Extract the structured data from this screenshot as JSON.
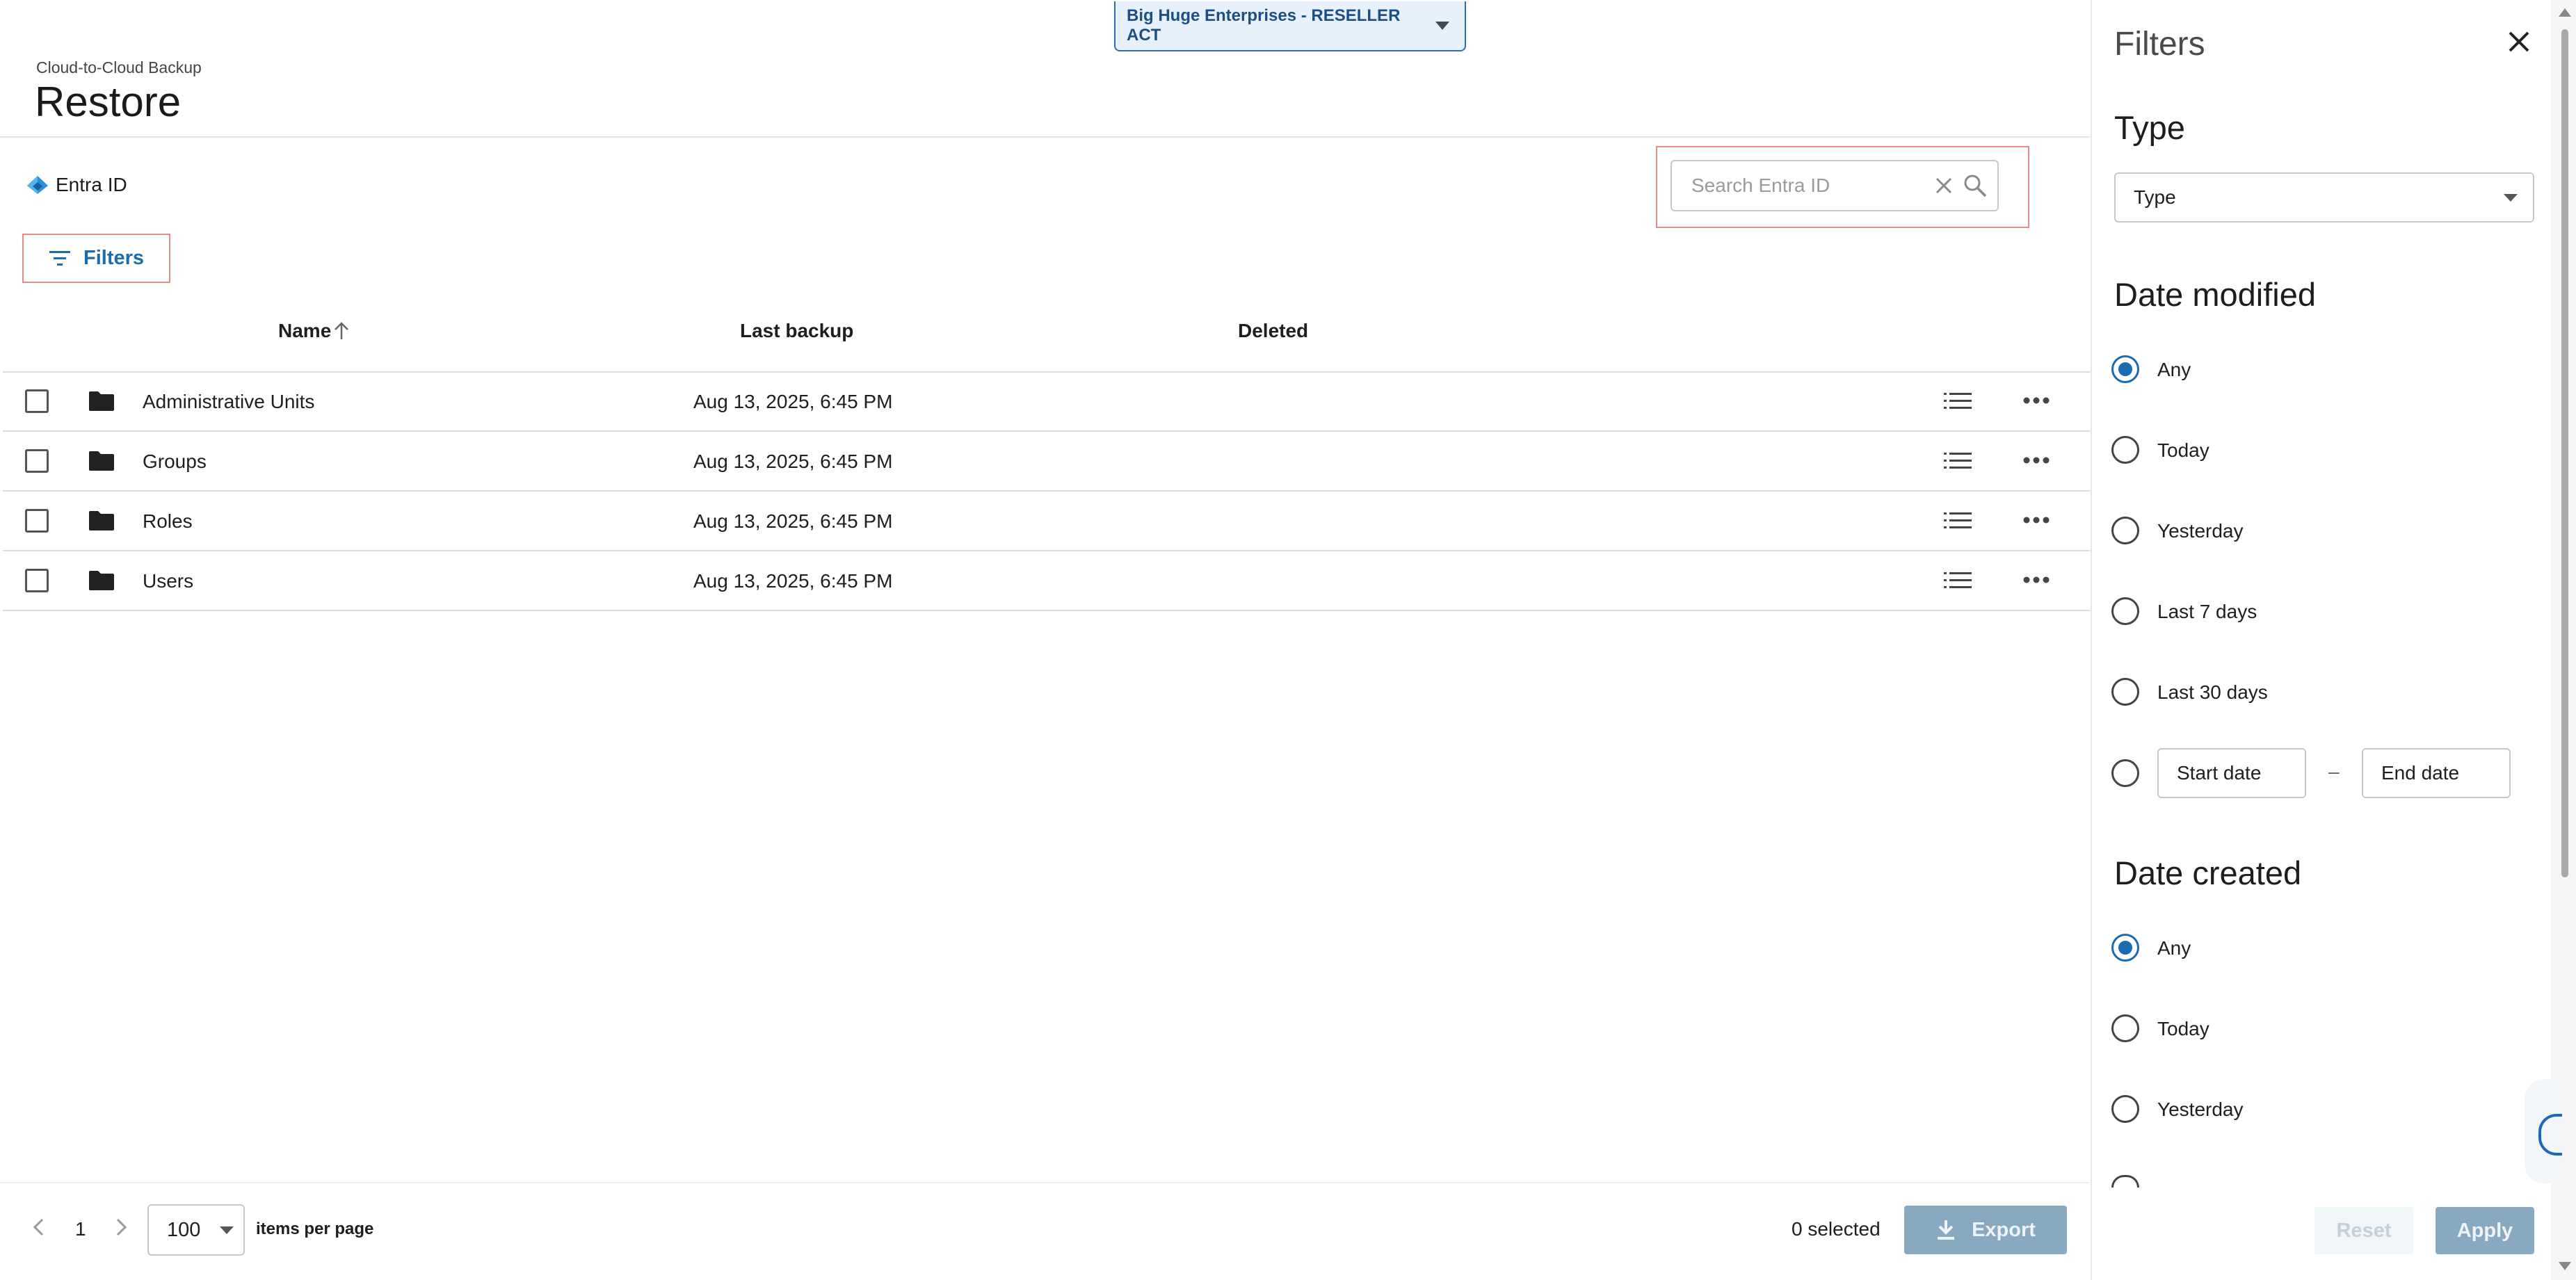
{
  "tenant_selector": {
    "label": "Big Huge Enterprises - RESELLER ACT"
  },
  "header": {
    "breadcrumb": "Cloud-to-Cloud Backup",
    "title": "Restore"
  },
  "source": {
    "label": "Entra ID",
    "icon": "entra-id-icon"
  },
  "search": {
    "placeholder": "Search Entra ID",
    "value": ""
  },
  "filters_button": {
    "label": "Filters"
  },
  "table": {
    "columns": [
      {
        "label": "Name",
        "sort": "ascending"
      },
      {
        "label": "Last backup"
      },
      {
        "label": "Deleted"
      }
    ],
    "rows": [
      {
        "name": "Administrative Units",
        "last_backup": "Aug 13, 2025, 6:45 PM",
        "deleted": ""
      },
      {
        "name": "Groups",
        "last_backup": "Aug 13, 2025, 6:45 PM",
        "deleted": ""
      },
      {
        "name": "Roles",
        "last_backup": "Aug 13, 2025, 6:45 PM",
        "deleted": ""
      },
      {
        "name": "Users",
        "last_backup": "Aug 13, 2025, 6:45 PM",
        "deleted": ""
      }
    ]
  },
  "pagination": {
    "page": "1",
    "per_page": "100",
    "per_page_label": "items per page"
  },
  "footer": {
    "selected": "0 selected",
    "export_label": "Export"
  },
  "filter_panel": {
    "title": "Filters",
    "type_section": {
      "heading": "Type",
      "select_value": "Type"
    },
    "date_modified": {
      "heading": "Date modified",
      "options": [
        "Any",
        "Today",
        "Yesterday",
        "Last 7 days",
        "Last 30 days"
      ],
      "selected": "Any",
      "start_placeholder": "Start date",
      "end_placeholder": "End date",
      "range_separator": "–"
    },
    "date_created": {
      "heading": "Date created",
      "options": [
        "Any",
        "Today",
        "Yesterday"
      ],
      "selected": "Any"
    },
    "reset_label": "Reset",
    "apply_label": "Apply"
  },
  "colors": {
    "accent": "#1a6bb0",
    "button_disabled": "#89a9c1",
    "highlight_outline": "#e78a8a"
  }
}
